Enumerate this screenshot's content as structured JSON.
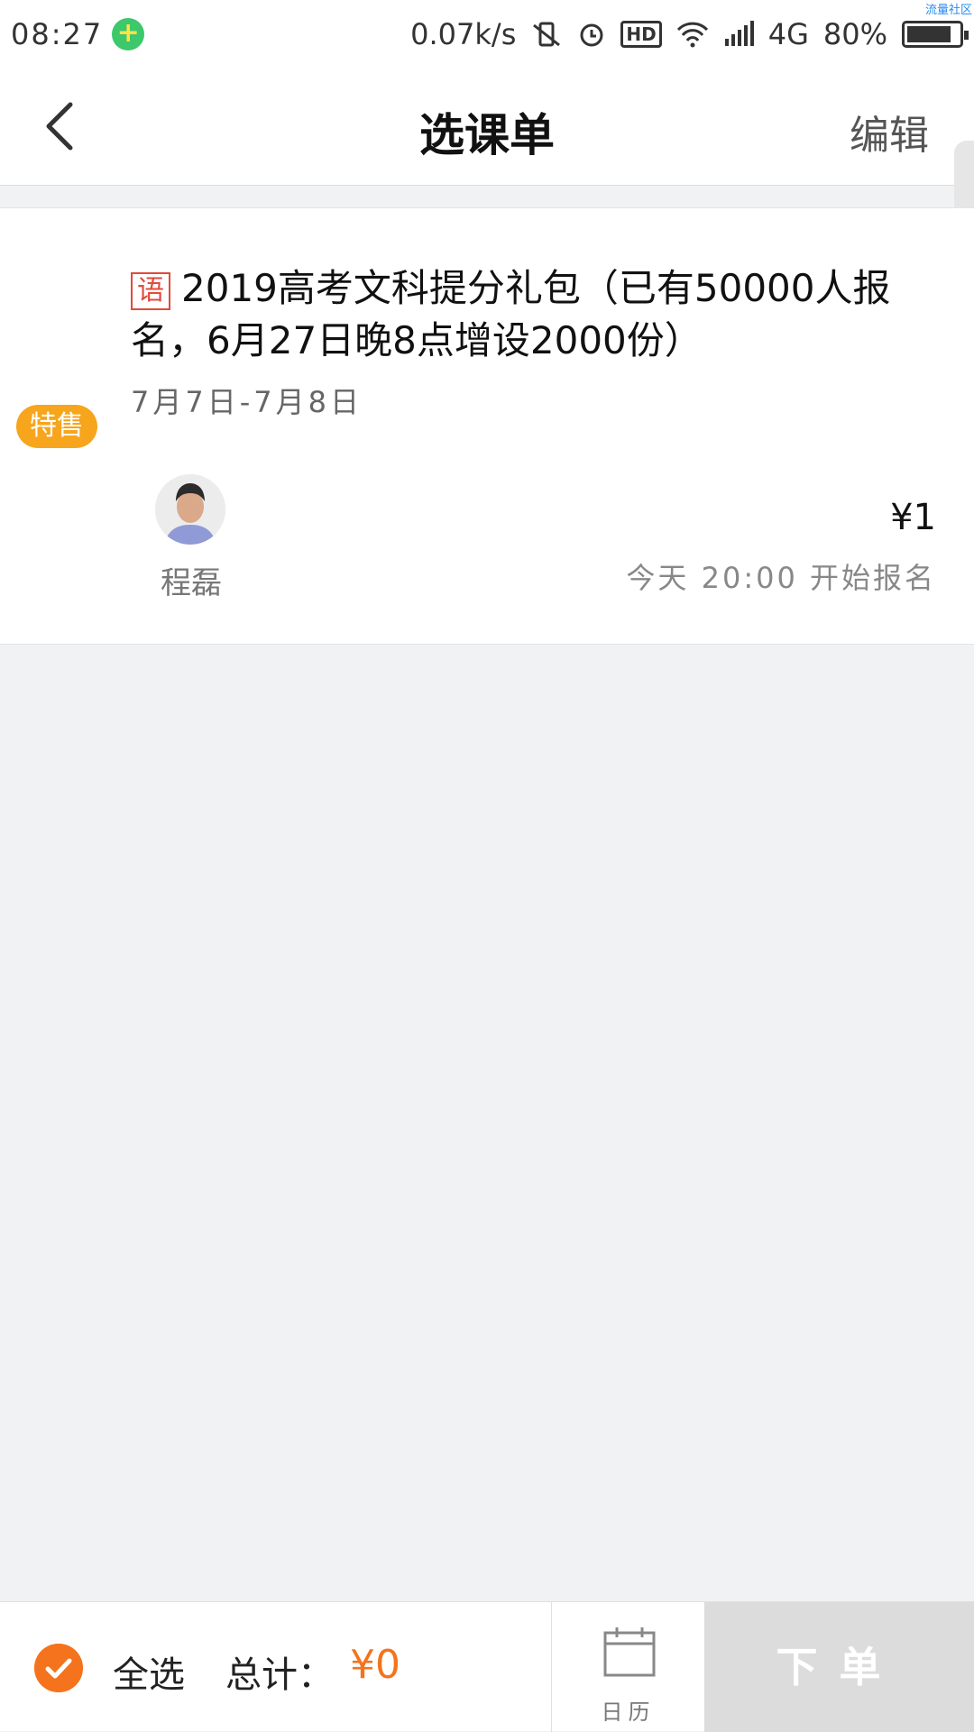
{
  "status_bar": {
    "time": "08:27",
    "net_speed": "0.07k/s",
    "hd": "HD",
    "network": "4G",
    "battery": "80%",
    "watermark": "流量社区"
  },
  "header": {
    "title": "选课单",
    "edit_label": "编辑"
  },
  "course": {
    "subject_tag": "语",
    "title": "2019高考文科提分礼包（已有50000人报名，6月27日晚8点增设2000份）",
    "date_range": "7月7日-7月8日",
    "badge": "特售",
    "teacher_name": "程磊",
    "price": "¥1",
    "enroll_time": "今天 20:00 开始报名"
  },
  "footer": {
    "select_all_label": "全选",
    "total_label": "总计：",
    "total_value": "¥0",
    "calendar_label": "日历",
    "order_label": "下单"
  },
  "colors": {
    "accent": "#f4731c",
    "badge": "#f7a51d",
    "subject_tag": "#e24a3a",
    "order_disabled": "#dcdcdc"
  }
}
